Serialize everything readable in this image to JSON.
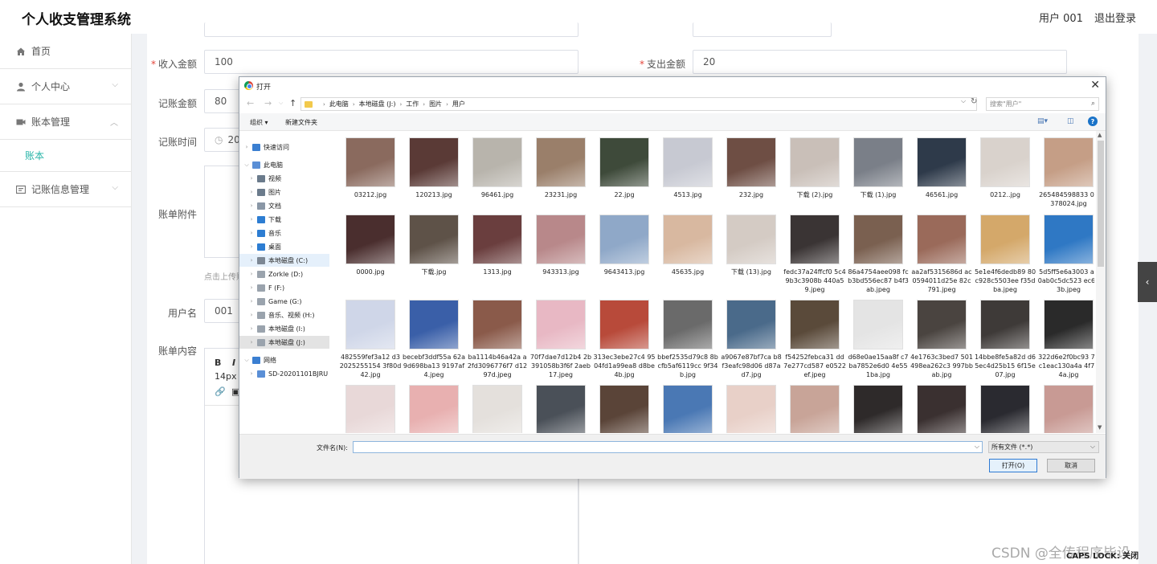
{
  "header": {
    "title": "个人收支管理系统",
    "user": "用户 001",
    "logout": "退出登录"
  },
  "sidebar": {
    "items": [
      {
        "label": "首页",
        "icon": "home-icon"
      },
      {
        "label": "个人中心",
        "icon": "user-icon"
      },
      {
        "label": "账本管理",
        "icon": "ledger-icon"
      },
      {
        "label": "记账信息管理",
        "icon": "records-icon"
      }
    ],
    "sub_item": "账本"
  },
  "form": {
    "income_label": "收入金额",
    "income_value": "100",
    "expense_label": "支出金额",
    "expense_value": "20",
    "record_amount_label": "记账金额",
    "record_amount_value": "80",
    "record_time_label": "记账时间",
    "record_time_value": "202",
    "attachment_label": "账单附件",
    "upload_hint": "点击上传账",
    "username_label": "用户名",
    "username_value": "001",
    "content_label": "账单内容",
    "font_size": "14px",
    "editor_tools": [
      "B",
      "I"
    ]
  },
  "watermark": "CSDN @全传程序毕设",
  "capslock": "CAPS LOCK: 关闭",
  "dialog": {
    "title": "打开",
    "breadcrumb": [
      "此电脑",
      "本地磁盘 (J:)",
      "工作",
      "图片",
      "用户"
    ],
    "search_placeholder": "搜索\"用户\"",
    "organize": "组织 ▾",
    "new_folder": "新建文件夹",
    "tree": [
      {
        "label": "快速访问",
        "icon_color": "#3b7fd1",
        "level": 0
      },
      {
        "label": "此电脑",
        "icon_color": "#5a8fd6",
        "level": 0
      },
      {
        "label": "视频",
        "icon_color": "#6b7b8c",
        "level": 1
      },
      {
        "label": "图片",
        "icon_color": "#6b7b8c",
        "level": 1
      },
      {
        "label": "文档",
        "icon_color": "#8a97a6",
        "level": 1
      },
      {
        "label": "下载",
        "icon_color": "#2d7dd2",
        "level": 1
      },
      {
        "label": "音乐",
        "icon_color": "#2d7dd2",
        "level": 1
      },
      {
        "label": "桌面",
        "icon_color": "#2d7dd2",
        "level": 1
      },
      {
        "label": "本地磁盘 (C:)",
        "icon_color": "#7c8794",
        "level": 1
      },
      {
        "label": "Zorkle (D:)",
        "icon_color": "#9aa3ad",
        "level": 1
      },
      {
        "label": "F (F:)",
        "icon_color": "#9aa3ad",
        "level": 1
      },
      {
        "label": "Game (G:)",
        "icon_color": "#9aa3ad",
        "level": 1
      },
      {
        "label": "音乐、视频 (H:)",
        "icon_color": "#9aa3ad",
        "level": 1
      },
      {
        "label": "本地磁盘 (I:)",
        "icon_color": "#9aa3ad",
        "level": 1
      },
      {
        "label": "本地磁盘 (J:)",
        "icon_color": "#9aa3ad",
        "level": 1
      },
      {
        "label": "网络",
        "icon_color": "#3b7fd1",
        "level": 0
      },
      {
        "label": "SD-20201101BJRU",
        "icon_color": "#5a8fd6",
        "level": 1
      }
    ],
    "files": [
      {
        "name": "03212.jpg",
        "color": "#8a6a5e"
      },
      {
        "name": "120213.jpg",
        "color": "#5a3a36"
      },
      {
        "name": "96461.jpg",
        "color": "#b8b4ac"
      },
      {
        "name": "23231.jpg",
        "color": "#9a7f6a"
      },
      {
        "name": "22.jpg",
        "color": "#3e4a3a"
      },
      {
        "name": "4513.jpg",
        "color": "#c7c9d2"
      },
      {
        "name": "232.jpg",
        "color": "#6e4e44"
      },
      {
        "name": "下载 (2).jpg",
        "color": "#c9bfb8"
      },
      {
        "name": "下载 (1).jpg",
        "color": "#7a7f88"
      },
      {
        "name": "46561.jpg",
        "color": "#2e3a4a"
      },
      {
        "name": "0212..jpg",
        "color": "#d9d2cc"
      },
      {
        "name": "265484598833 04378024.jpg",
        "color": "#c59e86"
      },
      {
        "name": "0000.jpg",
        "color": "#4a2e2e"
      },
      {
        "name": "下载.jpg",
        "color": "#5e5248"
      },
      {
        "name": "1313.jpg",
        "color": "#6a3e3e"
      },
      {
        "name": "943313.jpg",
        "color": "#b8888a"
      },
      {
        "name": "9643413.jpg",
        "color": "#8fa8c8"
      },
      {
        "name": "45635.jpg",
        "color": "#d8b8a0"
      },
      {
        "name": "下载 (13).jpg",
        "color": "#d4cbc4"
      },
      {
        "name": "fedc37a24ffcf0 5c49b3c3908b 440a59.jpeg",
        "color": "#3a3434"
      },
      {
        "name": "86a4754aee098 fcb3bd556ec87 b4f3ab.jpeg",
        "color": "#7a6050"
      },
      {
        "name": "aa2af5315686d ac0594011d25e 82c791.jpeg",
        "color": "#9a6a5a"
      },
      {
        "name": "5e1e4f6dedb89 80c928c5503ee f35dba.jpeg",
        "color": "#d4a86a"
      },
      {
        "name": "5d5ff5e6a3003 a20ab0c5dc523 ec623b.jpeg",
        "color": "#2f78c4"
      },
      {
        "name": "482559fef3a12 d32025255154 3f80d42.jpg",
        "color": "#cfd6e8"
      },
      {
        "name": "becebf3ddf55a 62a9d698ba13 9197af4.jpeg",
        "color": "#3a5fa8"
      },
      {
        "name": "ba1114b46a42a a2fd3096776f7 d1297d.jpeg",
        "color": "#8a5a4a"
      },
      {
        "name": "70f7dae7d12b4 2b391058b3f6f 2aeb17.jpeg",
        "color": "#e8b8c4"
      },
      {
        "name": "313ec3ebe27c4 9504fd1a99ea8 d8be4b.jpg",
        "color": "#b84a3a"
      },
      {
        "name": "bbef2535d79c8 8bcfb5af6119cc 9f34b.jpg",
        "color": "#6a6a6a"
      },
      {
        "name": "a9067e87bf7ca b8f3eafc98d06 d87ad7.jpg",
        "color": "#4a6a8a"
      },
      {
        "name": "f54252febca31 dd7e277cd587 e0522ef.jpeg",
        "color": "#5a4a3a"
      },
      {
        "name": "d68e0ae15aa8f c7ba7852e6d0 4e551ba.jpg",
        "color": "#e4e4e4"
      },
      {
        "name": "4e1763c3bed7 501498ea262c3 997bbab.jpg",
        "color": "#4a4440"
      },
      {
        "name": "14bbe8fe5a82d d65ec4d25b15 6f15e07.jpg",
        "color": "#3e3a38"
      },
      {
        "name": "322d6e2f0bc93 78c1eac130a4a 4f7b4a.jpg",
        "color": "#2a2a2a"
      },
      {
        "name": "",
        "color": "#e8d8d8"
      },
      {
        "name": "",
        "color": "#e8b0b0"
      },
      {
        "name": "",
        "color": "#e4e0dc"
      },
      {
        "name": "",
        "color": "#4a5058"
      },
      {
        "name": "",
        "color": "#5a4438"
      },
      {
        "name": "",
        "color": "#4a78b4"
      },
      {
        "name": "",
        "color": "#e8d0c8"
      },
      {
        "name": "",
        "color": "#c8a498"
      },
      {
        "name": "",
        "color": "#2e2a2a"
      },
      {
        "name": "",
        "color": "#3a3030"
      },
      {
        "name": "",
        "color": "#2a2a30"
      },
      {
        "name": "",
        "color": "#c89a94"
      }
    ],
    "filename_label": "文件名(N):",
    "filetype": "所有文件 (*.*)",
    "open_button": "打开(O)",
    "cancel_button": "取消"
  }
}
